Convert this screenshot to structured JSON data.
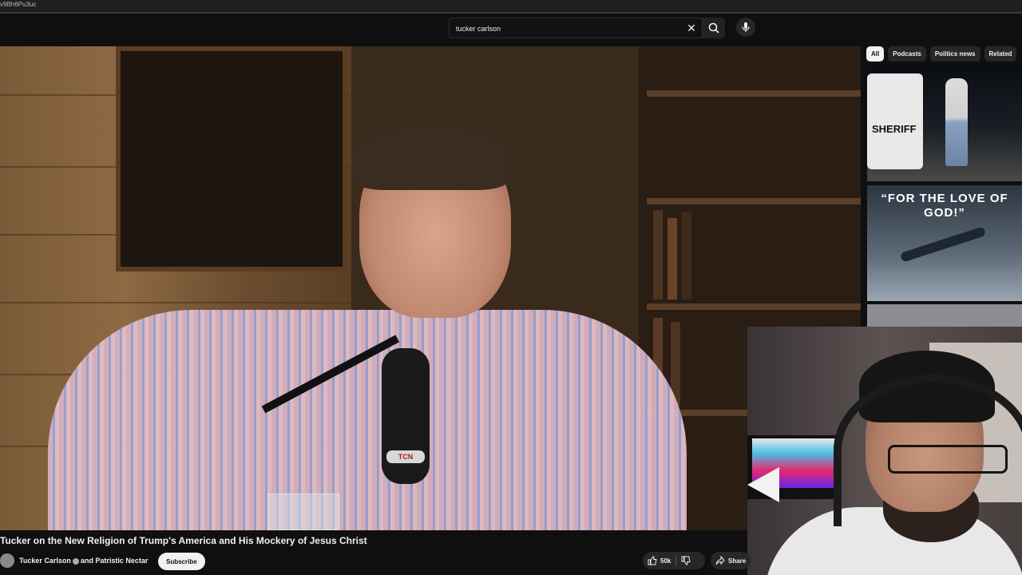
{
  "url_bar": {
    "text": "v9Bh6Pu3uc"
  },
  "search": {
    "query": "tucker carlson"
  },
  "chips": [
    {
      "label": "All",
      "active": true
    },
    {
      "label": "Podcasts",
      "active": false
    },
    {
      "label": "Politics news",
      "active": false
    },
    {
      "label": "Related",
      "active": false
    }
  ],
  "related": {
    "thumb1_text": "SHERIFF",
    "thumb2_text": "“FOR THE LOVE OF GOD!”"
  },
  "video": {
    "overlay_logo": "TCN",
    "title": "Tucker on the New Religion of Trump's America and His Mockery of Jesus Christ",
    "channel": "Tucker Carlson",
    "channel_suffix": "and Patristic Nectar",
    "subscribe_label": "Subscribe",
    "likes": "50k",
    "share_label": "Share"
  },
  "icons": {
    "clear": "close-icon",
    "search": "search-icon",
    "mic": "microphone-icon",
    "like": "thumbs-up-icon",
    "dislike": "thumbs-down-icon",
    "share": "share-icon",
    "verified": "verified-icon"
  },
  "colors": {
    "background": "#0f0f0f",
    "chip_active": "#f1f1f1",
    "chip": "#272727",
    "text": "#f1f1f1"
  }
}
